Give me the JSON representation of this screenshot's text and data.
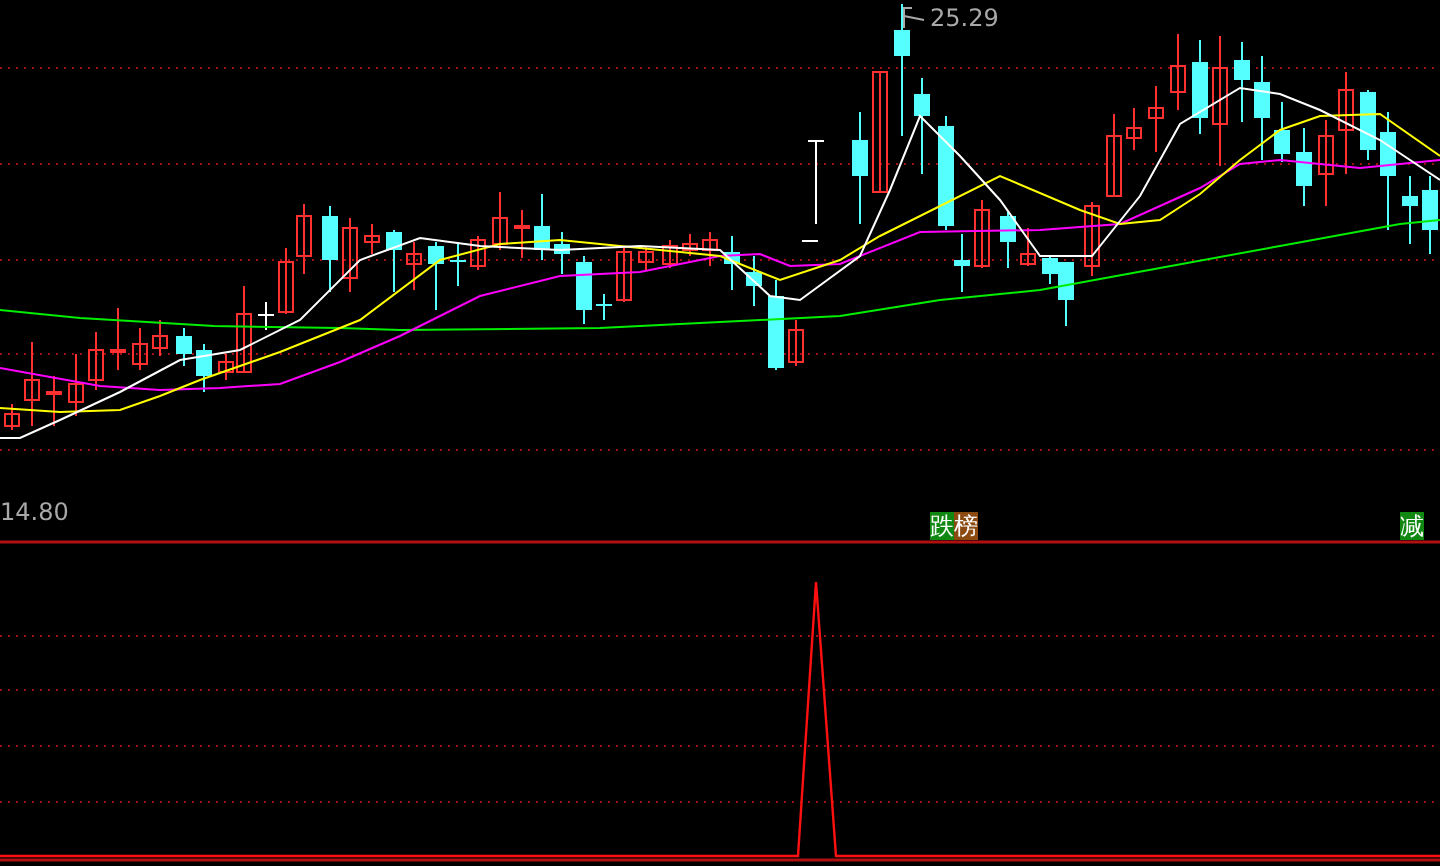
{
  "price_chart": {
    "high_label": "25.29",
    "low_label": "14.80"
  },
  "markers": [
    {
      "tags": [
        {
          "label": "跌",
          "color": "#118811"
        },
        {
          "label": "榜",
          "color": "#8a4a10"
        }
      ]
    },
    {
      "tags": [
        {
          "label": "减",
          "color": "#118811"
        }
      ]
    }
  ]
}
